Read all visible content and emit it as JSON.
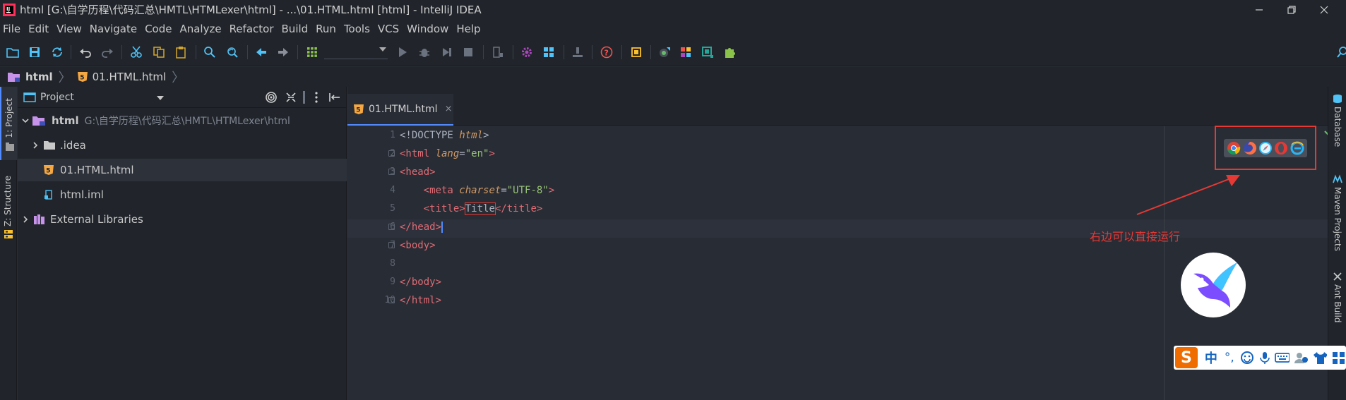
{
  "window": {
    "title": "html [G:\\自学历程\\代码汇总\\HMTL\\HTMLexer\\html] - ...\\01.HTML.html [html] - IntelliJ IDEA"
  },
  "menu": {
    "items": [
      "File",
      "Edit",
      "View",
      "Navigate",
      "Code",
      "Analyze",
      "Refactor",
      "Build",
      "Run",
      "Tools",
      "VCS",
      "Window",
      "Help"
    ]
  },
  "breadcrumb": {
    "items": [
      "html",
      "01.HTML.html"
    ]
  },
  "tool_windows": {
    "left": [
      "1: Project",
      "Z: Structure"
    ],
    "right": [
      "Database",
      "Maven Projects",
      "Ant Build"
    ]
  },
  "project_panel": {
    "title": "Project",
    "root": {
      "name": "html",
      "path": "G:\\自学历程\\代码汇总\\HMTL\\HTMLexer\\html"
    },
    "items": [
      {
        "name": ".idea",
        "type": "folder"
      },
      {
        "name": "01.HTML.html",
        "type": "html-file"
      },
      {
        "name": "html.iml",
        "type": "iml-file"
      },
      {
        "name": "External Libraries",
        "type": "library"
      }
    ]
  },
  "editor": {
    "tab_label": "01.HTML.html",
    "tab_close": "×",
    "line_numbers": [
      "1",
      "2",
      "3",
      "4",
      "5",
      "6",
      "7",
      "8",
      "9",
      "10"
    ],
    "code": {
      "l1_open": "<!DOCTYPE ",
      "l1_kw": "html",
      "l1_close": ">",
      "l2_tag": "<html ",
      "l2_attr": "lang",
      "l2_eq": "=",
      "l2_val": "\"en\"",
      "l2_end": ">",
      "l3": "<head>",
      "l4_indent": "    ",
      "l4_tag": "<meta ",
      "l4_attr": "charset",
      "l4_eq": "=",
      "l4_val": "\"UTF-8\"",
      "l4_end": ">",
      "l5_indent": "    ",
      "l5_open": "<title>",
      "l5_text": "Title",
      "l5_close": "</title>",
      "l6": "</head>",
      "l7": "<body>",
      "l8": "",
      "l9": "</body>",
      "l10": "</html>"
    }
  },
  "annotation": {
    "text": "右边可以直接运行"
  },
  "ime": {
    "logo": "S",
    "mode": "中",
    "punct": "°,"
  },
  "colors": {
    "accent": "#528bff",
    "annotation": "#e53935"
  }
}
